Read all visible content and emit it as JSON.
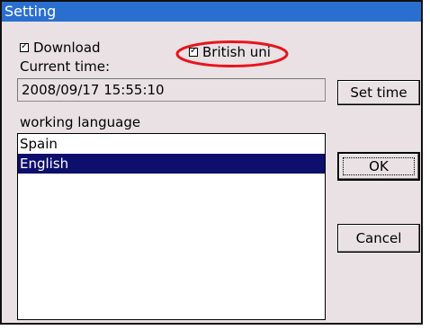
{
  "window": {
    "title": "Setting"
  },
  "options": {
    "download_label": "Download",
    "download_checked": true,
    "british_uni_label": "British uni",
    "british_uni_checked": true
  },
  "time": {
    "label": "Current time:",
    "value": "2008/09/17 15:55:10",
    "set_time_label": "Set time"
  },
  "language": {
    "label": "working language",
    "items": [
      {
        "label": "Spain",
        "selected": false
      },
      {
        "label": "English",
        "selected": true
      }
    ]
  },
  "buttons": {
    "ok_label": "OK",
    "cancel_label": "Cancel"
  },
  "annotation": {
    "ellipse_color": "#e8141c"
  },
  "colors": {
    "titlebar": "#2a6fd0",
    "dialog_background": "#e9e1e4",
    "selection": "#0e0f6d"
  }
}
